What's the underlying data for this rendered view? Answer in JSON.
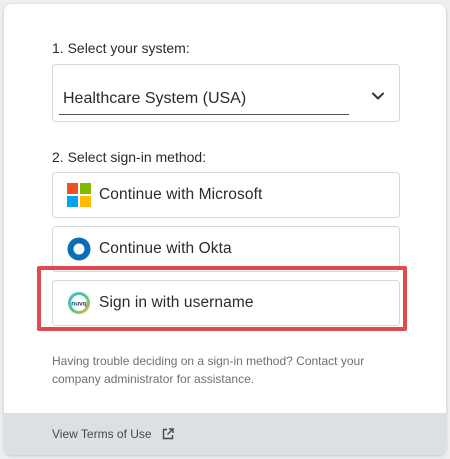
{
  "step1": {
    "label": "1. Select your system:"
  },
  "system_select": {
    "value": "Healthcare System (USA)",
    "icon": "chevron-down-icon"
  },
  "step2": {
    "label": "2. Select sign-in method:"
  },
  "methods": [
    {
      "label": "Continue with Microsoft",
      "icon": "microsoft-logo-icon"
    },
    {
      "label": "Continue with Okta",
      "icon": "okta-logo-icon"
    },
    {
      "label": "Sign in with username",
      "icon": "user-logo-icon",
      "logo_text": "nuvq"
    }
  ],
  "help_text": "Having trouble deciding on a sign-in method? Contact your company administrator for assistance.",
  "footer": {
    "terms_label": "View Terms of Use",
    "icon": "external-link-icon"
  },
  "colors": {
    "highlight": "#e04a4f",
    "okta_blue": "#0b6fb8",
    "ms_red": "#f25022",
    "ms_green": "#7fba00",
    "ms_blue": "#00a4ef",
    "ms_yellow": "#ffb900"
  }
}
